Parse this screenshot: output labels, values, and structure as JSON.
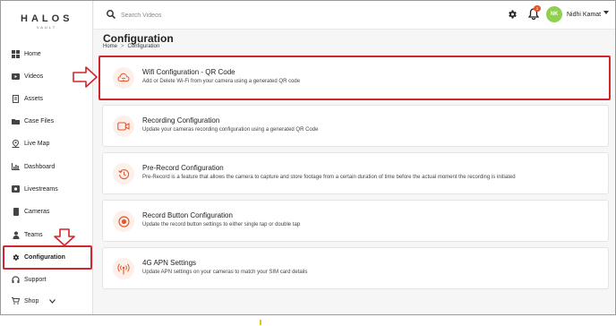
{
  "logo": {
    "text": "HALOS",
    "subtext": "VAULT"
  },
  "sidebar": {
    "items": [
      {
        "label": "Home",
        "icon": "grid-icon"
      },
      {
        "label": "Videos",
        "icon": "video-icon"
      },
      {
        "label": "Assets",
        "icon": "document-icon"
      },
      {
        "label": "Case Files",
        "icon": "folder-icon"
      },
      {
        "label": "Live Map",
        "icon": "map-icon"
      },
      {
        "label": "Dashboard",
        "icon": "bar-chart-icon"
      },
      {
        "label": "Livestreams",
        "icon": "livestream-icon"
      },
      {
        "label": "Cameras",
        "icon": "camera-icon"
      },
      {
        "label": "Teams",
        "icon": "team-icon"
      },
      {
        "label": "Configuration",
        "icon": "gear-icon",
        "active": true
      },
      {
        "label": "Support",
        "icon": "headset-icon"
      },
      {
        "label": "Shop",
        "icon": "cart-icon"
      }
    ]
  },
  "header": {
    "search_placeholder": "Search Videos",
    "notification_count": "1",
    "avatar_initials": "NK",
    "user_name": "Nidhi Kamat"
  },
  "main": {
    "title": "Configuration",
    "breadcrumb": {
      "home": "Home",
      "separator": ">",
      "current": "Configuration"
    },
    "cards": [
      {
        "title": "Wifi Configuration - QR Code",
        "desc": "Add or Delete Wi-Fi from your camera using a generated QR code",
        "icon": "wifi-cloud-icon"
      },
      {
        "title": "Recording Configuration",
        "desc": "Update your cameras recording configuration using a generated QR Code",
        "icon": "video-camera-icon"
      },
      {
        "title": "Pre-Record Configuration",
        "desc": "Pre-Record is a feature that allows the camera to capture and store footage from a certain duration of time before the actual moment the recording is initiated",
        "icon": "history-icon"
      },
      {
        "title": "Record Button Configuration",
        "desc": "Update the record button settings to either single tap or double tap",
        "icon": "record-button-icon"
      },
      {
        "title": "4G APN Settings",
        "desc": "Update APN settings on your cameras to match your SIM card details",
        "icon": "antenna-icon"
      }
    ]
  },
  "colors": {
    "accent": "#e4572e",
    "highlight": "#d0262e",
    "avatar": "#8fd14f"
  }
}
